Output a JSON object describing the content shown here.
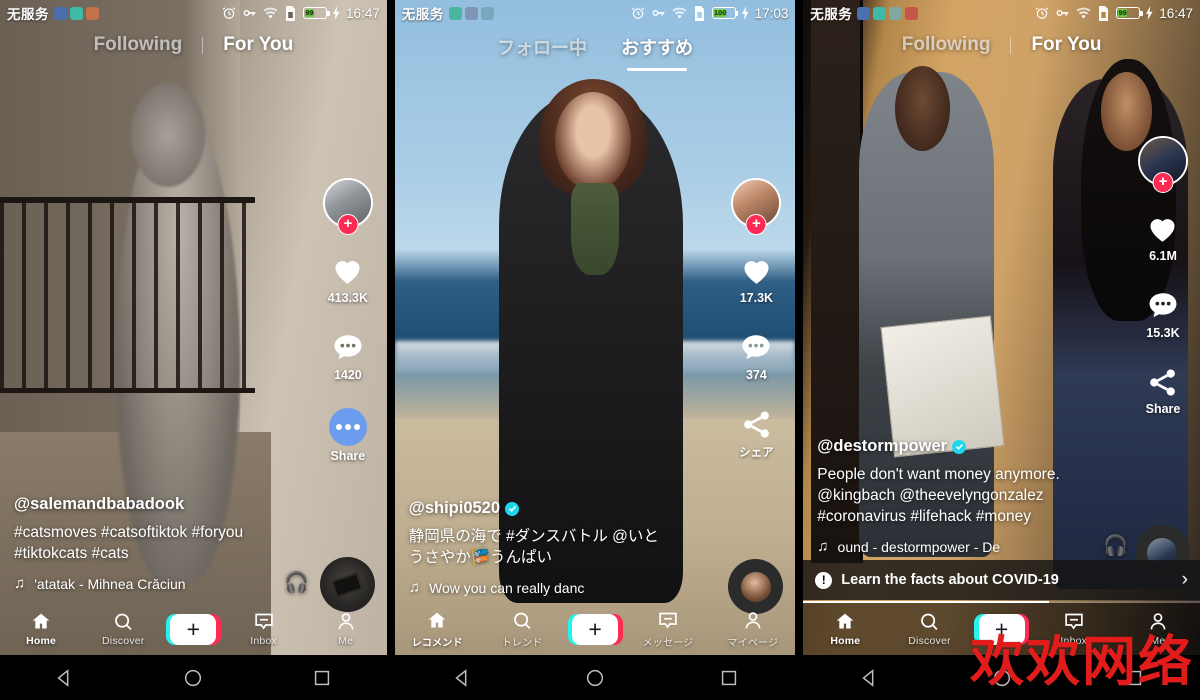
{
  "panels": [
    {
      "id": "panel-en-cat",
      "status": {
        "carrier": "无服务",
        "clock": "16:47",
        "battery": "99"
      },
      "tabs": {
        "following": "Following",
        "foryou": "For You",
        "active": "For You"
      },
      "actions": {
        "likes": "413.3K",
        "comments": "1420",
        "share_label": "Share",
        "share_style": "blue-dots"
      },
      "caption": {
        "handle": "@salemandbabadook",
        "verified": false,
        "description": "#catsmoves #catsoftiktok #foryou #tiktokcats #cats",
        "music": "'atatak - Mihnea Crăciun",
        "music_icon": "music-note-icon"
      },
      "nav": {
        "home": "Home",
        "discover": "Discover",
        "create": "+",
        "inbox": "Inbox",
        "me": "Me",
        "active": "Home"
      }
    },
    {
      "id": "panel-jp-beach",
      "status": {
        "carrier": "无服务",
        "clock": "17:03",
        "battery": "100"
      },
      "tabs": {
        "following": "フォロー中",
        "foryou": "おすすめ",
        "active": "おすすめ"
      },
      "actions": {
        "likes": "17.3K",
        "comments": "374",
        "share_label": "シェア",
        "share_style": "share-nodes"
      },
      "caption": {
        "handle": "@shipi0520",
        "verified": true,
        "description": "静岡県の海で #ダンスバトル @いとうさやか🎏うんぱい",
        "music": "Wow you can really danc",
        "music_icon": "music-note-icon"
      },
      "nav": {
        "home": "レコメンド",
        "discover": "トレンド",
        "create": "+",
        "inbox": "メッセージ",
        "me": "マイページ",
        "active": "レコメンド"
      }
    },
    {
      "id": "panel-en-destorm",
      "status": {
        "carrier": "无服务",
        "clock": "16:47",
        "battery": "99"
      },
      "tabs": {
        "following": "Following",
        "foryou": "For You",
        "active": "For You"
      },
      "actions": {
        "likes": "6.1M",
        "comments": "15.3K",
        "share_label": "Share",
        "share_style": "share-nodes"
      },
      "caption": {
        "handle": "@destormpower",
        "verified": true,
        "description": "People don't want money anymore. @kingbach @theevelyngonzalez #coronavirus #lifehack #money",
        "music": "ound - destormpower - De",
        "music_icon": "music-note-icon"
      },
      "banner": {
        "text": "Learn the facts about COVID-19",
        "progress_percent": 62
      },
      "nav": {
        "home": "Home",
        "discover": "Discover",
        "create": "+",
        "inbox": "Inbox",
        "me": "Me",
        "active": "Home"
      }
    }
  ],
  "watermark": {
    "text": "欢欢网络",
    "color": "#e21b1b"
  },
  "system_nav": {
    "back": "back-triangle-icon",
    "home": "home-circle-icon",
    "recents": "recents-square-icon"
  },
  "theme": {
    "accent_pink": "#fe2c55",
    "accent_cyan": "#25f4ee",
    "verified_blue": "#20d5ec",
    "share_blue": "#6b9cee"
  }
}
